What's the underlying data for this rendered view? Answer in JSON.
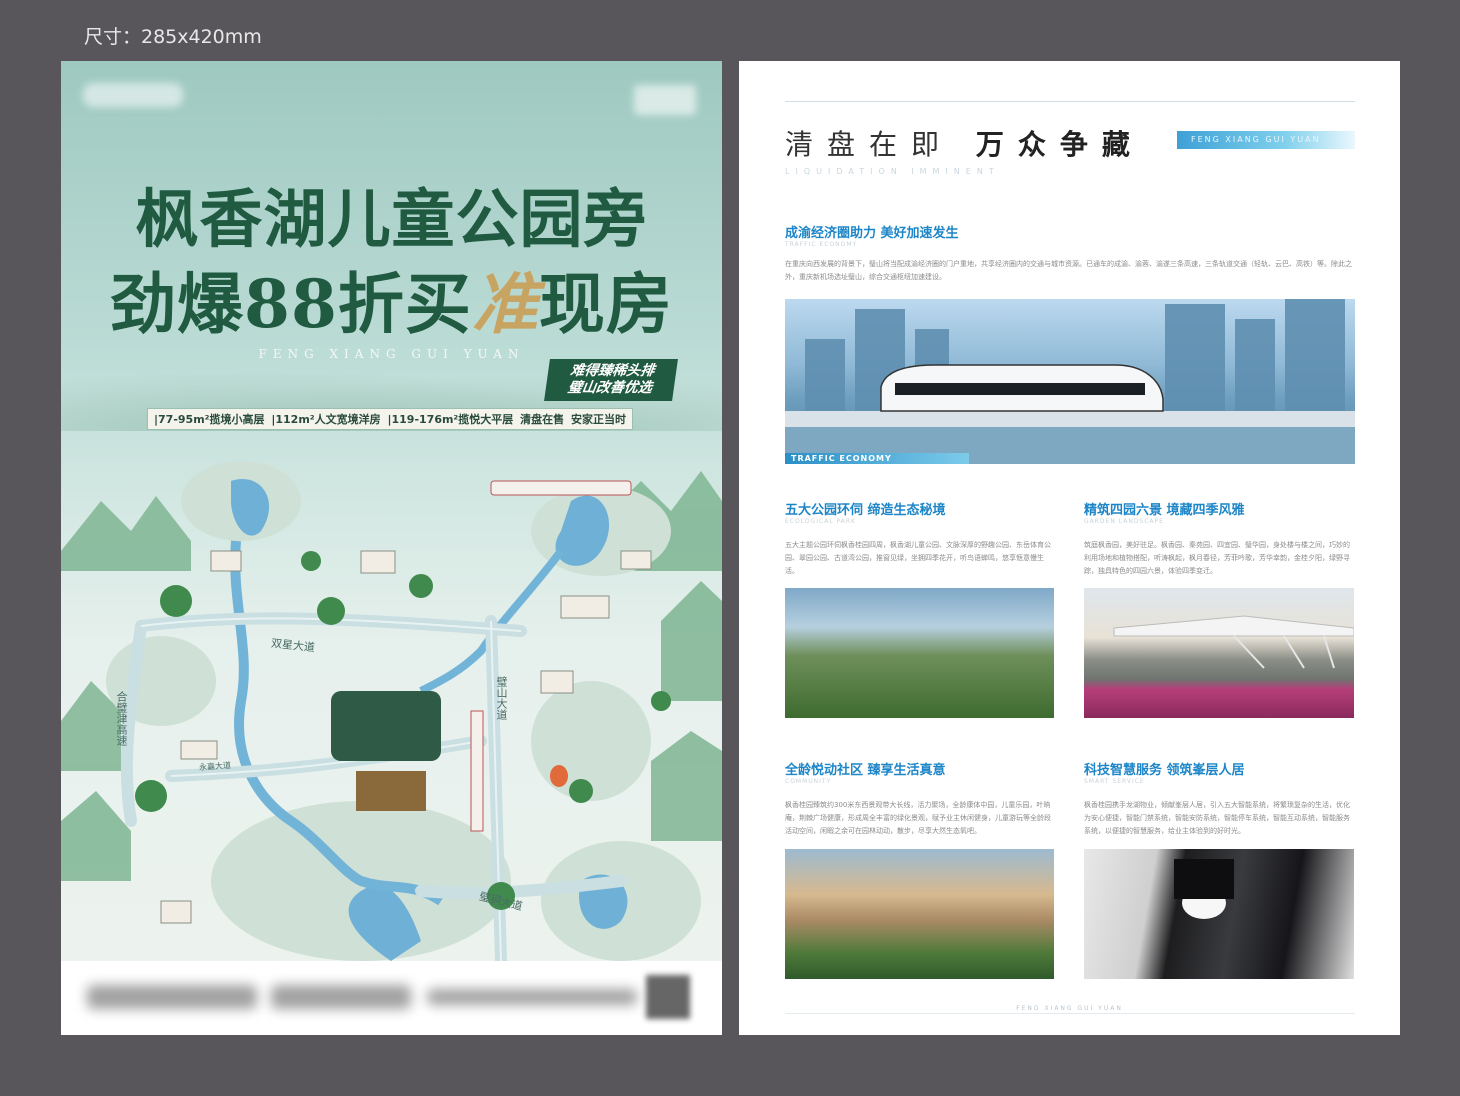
{
  "size_label": "尺寸：285x420mm",
  "front": {
    "headline_line1": "枫香湖儿童公园旁",
    "headline_line2_a": "劲爆88折买",
    "headline_line2_gold": "准",
    "headline_line2_b": "现房",
    "pinyin": "FENG XIANG GUI YUAN",
    "tag_line1": "难得臻稀头排",
    "tag_line2": "璧山改善优选",
    "features": [
      "|77-95m²揽境小高层",
      "|112m²人文宽境洋房",
      "|119-176m²揽悦大平层",
      "清盘在售",
      "安家正当时"
    ],
    "roads": {
      "shuangxing": "双星大道",
      "bishan": "璧山大道",
      "hebi": "合璧津高速",
      "yongjia": "永嘉大道",
      "bitong": "璧铜大道"
    }
  },
  "back": {
    "title_a": "清盘在即",
    "title_b": "万众争藏",
    "title_bar": "FENG XIANG GUI YUAN",
    "title_en": "LIQUIDATION IMMINENT",
    "sections": [
      {
        "title": "成渝经济圈助力 美好加速发生",
        "en": "TRAFFIC ECONOMY",
        "body": "在重庆向西发展的背景下，璧山将当配成渝经济圈的门户重地，共享经济圈内的交通与城市资源。已通车的成渝、渝蓉、渝遂三条高速，三条轨道交通（轻轨、云巴、高铁）等。除此之外，重庆新机场选址璧山，综合交通枢纽加速建设。"
      },
      {
        "title": "五大公园环伺 缔造生态秘境",
        "en": "ECOLOGICAL PARK",
        "body": "五大主题公园环伺枫香桂园四周，枫香湖儿童公园、文脉深厚的野趣公园、东岳体育公园、翠园公园、古道湾公园，推窗见绿，坐拥四季花开，听鸟语蝉鸣，悠享惬意慢生活。"
      },
      {
        "title": "精筑四园六景 境藏四季风雅",
        "en": "GARDEN LANDSCAPE",
        "body": "筑庭枫香园，美好驻足。枫香园、秦苑园、四宜园、璧华园，身处楼与楼之间，巧妙的利用场地和植物搭配，听涛枫起，枫月春径，芳菲吟歌，芳华幸韵，金桂夕阳，绿野寻踪，独具特色的四园六景，体验四季变迁。"
      },
      {
        "title": "全龄悦动社区 臻享生活真意",
        "en": "COMMUNITY",
        "body": "枫香桂园臻筑约300米东西景观带大长线，活力聚场，全龄康体中园，儿童乐园，叶晌庵，荆棘广场健康，形成周全丰富的绿化景观，赋予业主休闲健身，儿童游玩等全龄段活动空间，闲暇之余可在园林动动，散步，尽享大然生态氧吧。"
      },
      {
        "title": "科技智慧服务 领筑峯层人居",
        "en": "SMART SERVICE",
        "body": "枫香桂园携手龙湖物业，倾献峯层人居，引入五大智能系统，将繁琐复杂的生活，优化为安心便捷，智能门禁系统，智能安防系统，智能停车系统，智能互动系统，智能服务系统，以便捷的智慧服务，给业主体验到的好时光。"
      }
    ],
    "train_bar": "TRAFFIC ECONOMY",
    "footer": "FENG XIANG GUI YUAN"
  }
}
